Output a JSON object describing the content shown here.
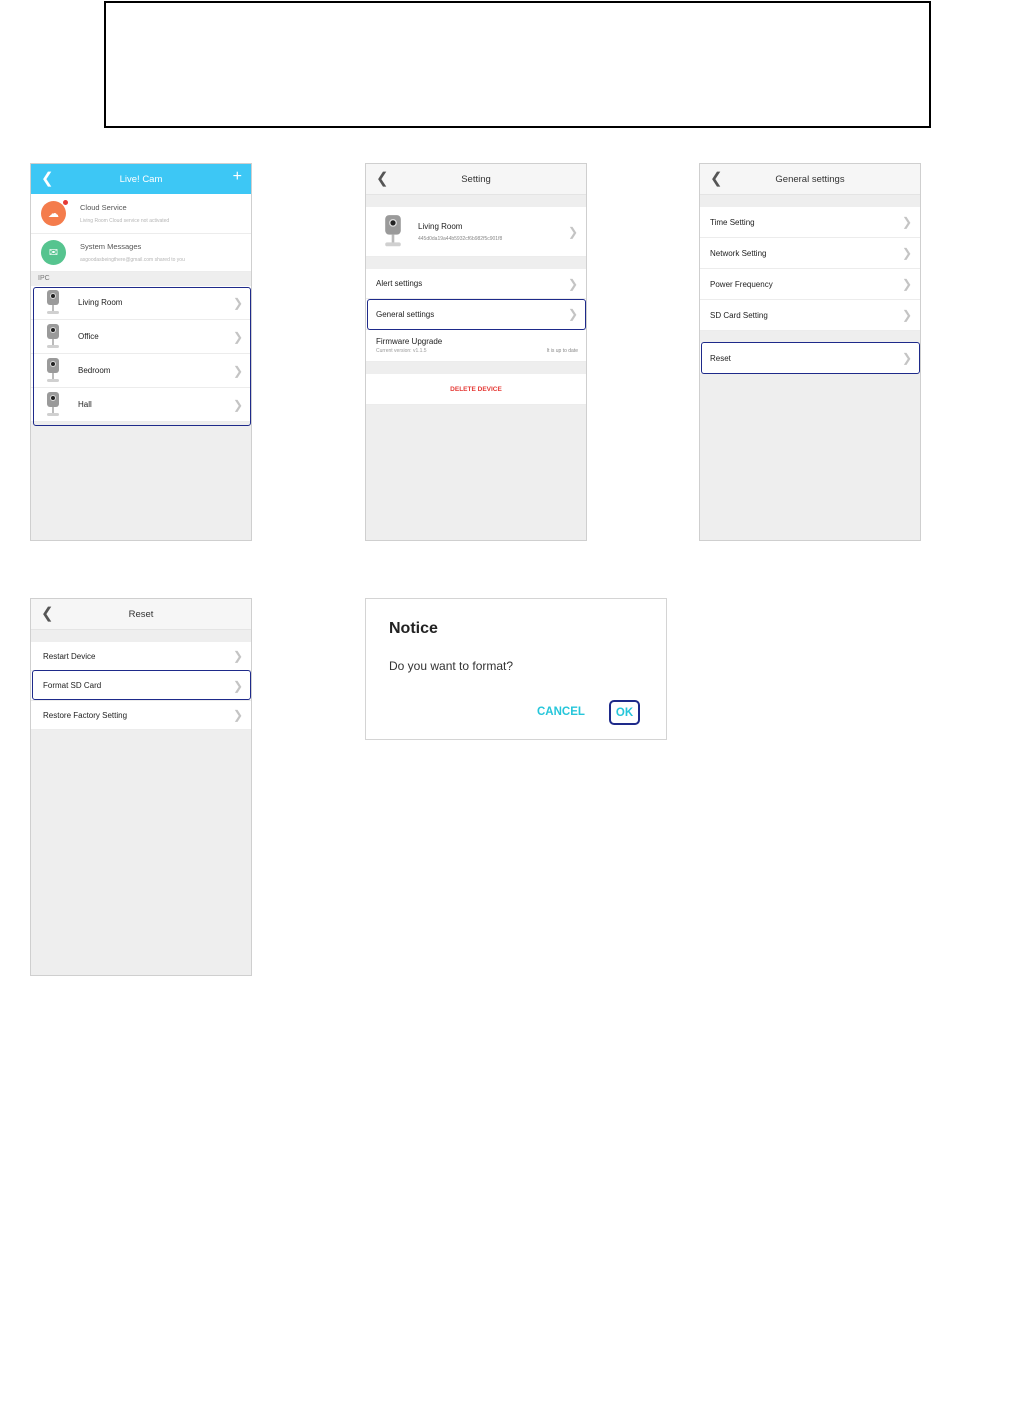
{
  "home": {
    "title": "Live! Cam",
    "cloud": {
      "title": "Cloud Service",
      "subtitle": "Living Room Cloud service not activated"
    },
    "system": {
      "title": "System Messages",
      "subtitle": "asgoodasbeingthere@gmail.com shared to you"
    },
    "section_label": "IPC",
    "devices": [
      "Living Room",
      "Office",
      "Bedroom",
      "Hall"
    ]
  },
  "setting": {
    "title": "Setting",
    "device_name": "Living Room",
    "device_id": "445d0da19a44b5932cf6b982f5c901f8",
    "alert": "Alert settings",
    "general": "General settings",
    "firmware_title": "Firmware Upgrade",
    "firmware_version": "Current version: v1.1.5",
    "firmware_status": "It is up to date",
    "delete": "DELETE DEVICE"
  },
  "general": {
    "title": "General settings",
    "items": [
      "Time Setting",
      "Network Setting",
      "Power Frequency",
      "SD Card Setting"
    ],
    "reset": "Reset"
  },
  "reset": {
    "title": "Reset",
    "items": [
      "Restart Device",
      "Format SD Card",
      "Restore Factory Setting"
    ]
  },
  "dialog": {
    "title": "Notice",
    "message": "Do you want to format?",
    "cancel": "CANCEL",
    "ok": "OK"
  },
  "colors": {
    "header_blue": "#3dc7f5",
    "highlight": "#1e2a8a",
    "delete_red": "#e53935",
    "dialog_button": "#26c6da",
    "cloud_orange": "#f47c4c",
    "message_green": "#56c48f"
  }
}
